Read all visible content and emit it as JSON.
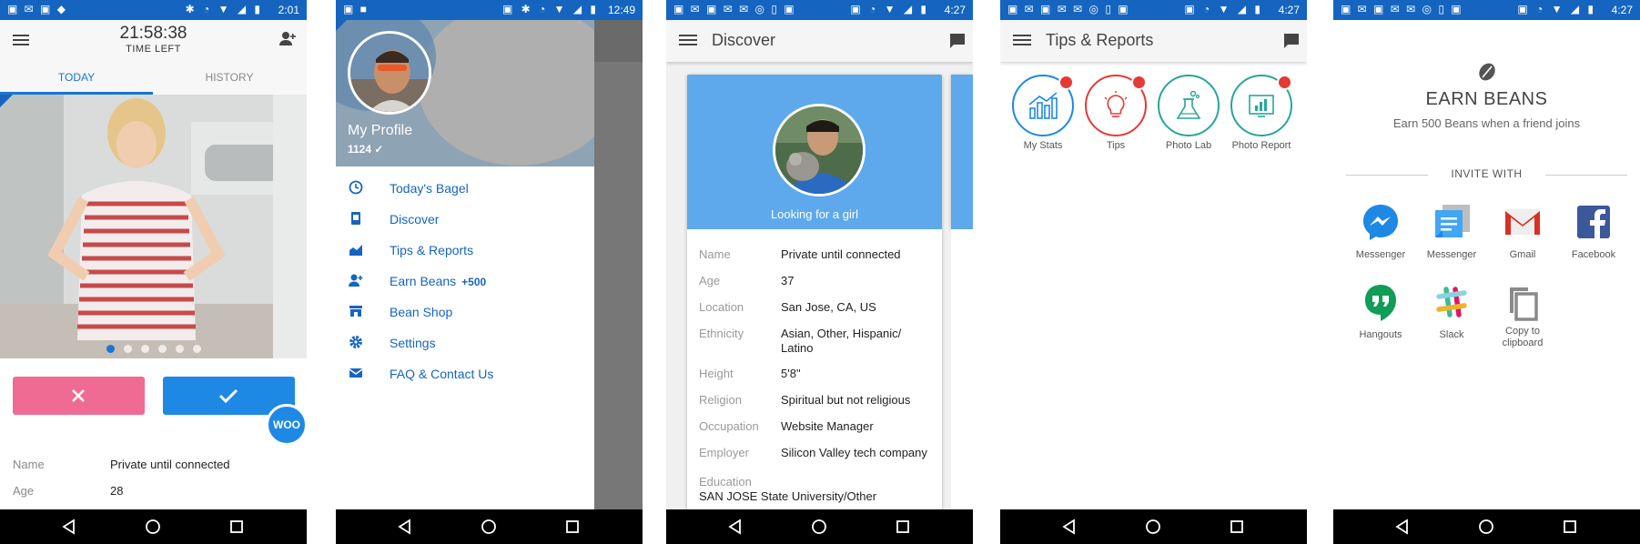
{
  "statusbars": [
    {
      "time": "2:01"
    },
    {
      "time": "12:49"
    },
    {
      "time": "4:27"
    },
    {
      "time": "4:27"
    },
    {
      "time": "4:27"
    }
  ],
  "today": {
    "timer": "21:58:38",
    "timer_label": "TIME LEFT",
    "tabs": [
      "TODAY",
      "HISTORY"
    ],
    "woo": "WOO",
    "details": [
      {
        "label": "Name",
        "value": "Private until connected"
      },
      {
        "label": "Age",
        "value": "28"
      }
    ]
  },
  "drawer": {
    "profile_name": "My Profile",
    "bean_count": "1124",
    "items": [
      {
        "label": "Today's Bagel",
        "icon": "clock-icon"
      },
      {
        "label": "Discover",
        "icon": "discover-icon"
      },
      {
        "label": "Tips & Reports",
        "icon": "chart-icon"
      },
      {
        "label": "Earn Beans",
        "icon": "add-person-icon",
        "bonus": "+500"
      },
      {
        "label": "Bean Shop",
        "icon": "store-icon"
      },
      {
        "label": "Settings",
        "icon": "gear-icon"
      },
      {
        "label": "FAQ & Contact Us",
        "icon": "mail-icon"
      }
    ]
  },
  "discover": {
    "title": "Discover",
    "looking_for": "Looking for a girl",
    "details": [
      {
        "label": "Name",
        "value": "Private until connected"
      },
      {
        "label": "Age",
        "value": "37"
      },
      {
        "label": "Location",
        "value": "San Jose, CA, US"
      },
      {
        "label": "Ethnicity",
        "value": "Asian, Other, Hispanic/ Latino"
      },
      {
        "label": "Height",
        "value": "5'8\""
      },
      {
        "label": "Religion",
        "value": "Spiritual but not religious"
      },
      {
        "label": "Occupation",
        "value": "Website Manager"
      },
      {
        "label": "Employer",
        "value": "Silicon Valley tech company"
      }
    ],
    "education_label": "Education",
    "education_value": "SAN JOSE State University/Other"
  },
  "tips": {
    "title": "Tips & Reports",
    "tiles": [
      {
        "label": "My Stats",
        "color": "#1e88e5"
      },
      {
        "label": "Tips",
        "color": "#e53935"
      },
      {
        "label": "Photo Lab",
        "color": "#26a69a"
      },
      {
        "label": "Photo Report",
        "color": "#26a69a"
      }
    ]
  },
  "earn": {
    "title": "EARN BEANS",
    "subtitle": "Earn 500 Beans when a friend joins",
    "invite_with": "INVITE WITH",
    "apps": [
      {
        "label": "Messenger",
        "icon": "messenger-icon"
      },
      {
        "label": "Messenger",
        "icon": "sms-messenger-icon"
      },
      {
        "label": "Gmail",
        "icon": "gmail-icon"
      },
      {
        "label": "Facebook",
        "icon": "facebook-icon"
      },
      {
        "label": "Hangouts",
        "icon": "hangouts-icon"
      },
      {
        "label": "Slack",
        "icon": "slack-icon"
      },
      {
        "label": "Copy to clipboard",
        "icon": "copy-icon"
      }
    ]
  },
  "colors": {
    "accent": "#1e88e5",
    "statusbar": "#1565c0",
    "pass": "#f06b93"
  }
}
